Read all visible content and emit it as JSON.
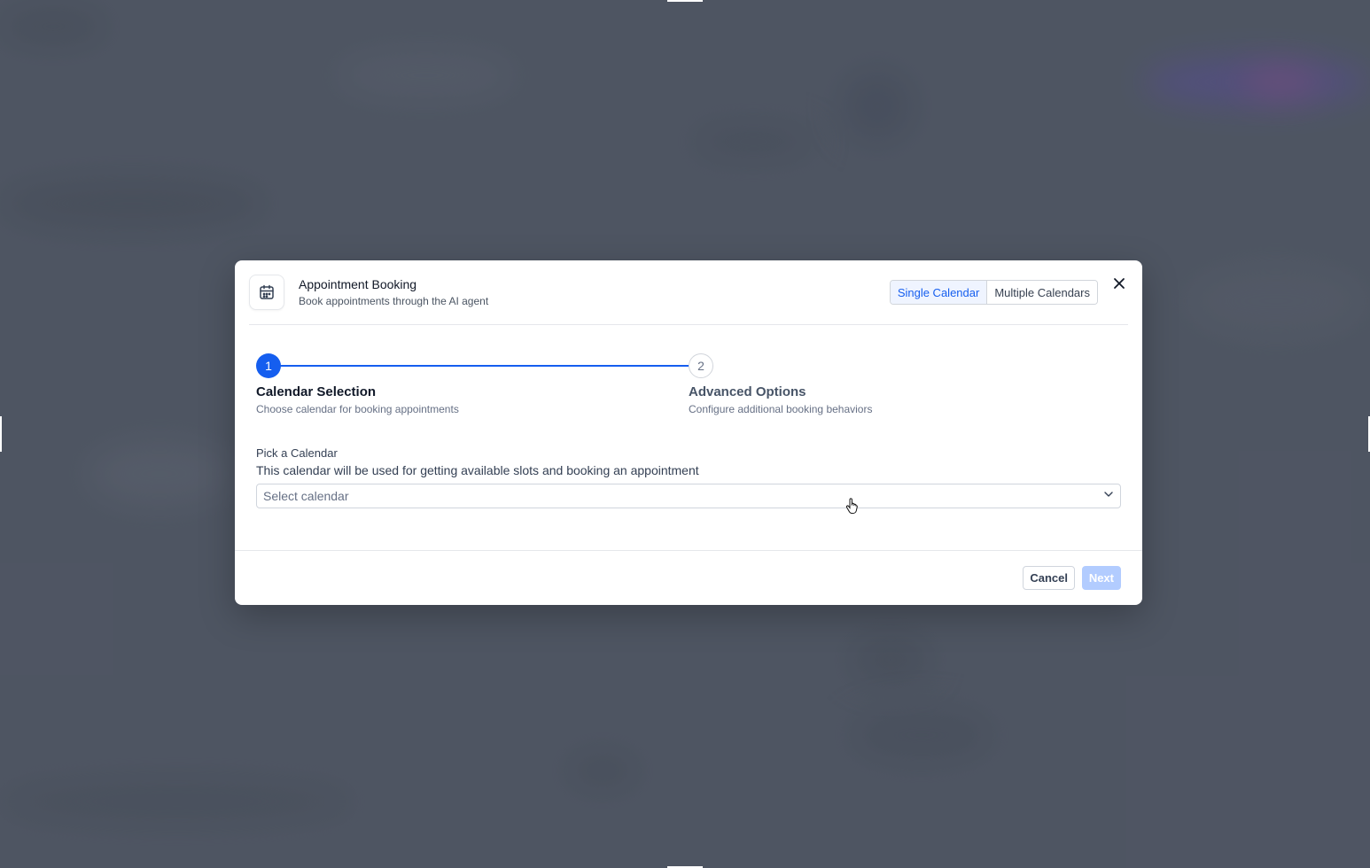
{
  "modal": {
    "title": "Appointment Booking",
    "subtitle": "Book appointments through the AI agent",
    "header_icon": "calendar-icon",
    "mode_toggle": {
      "options": [
        "Single Calendar",
        "Multiple Calendars"
      ],
      "selected": "Single Calendar"
    },
    "close_icon": "close-icon"
  },
  "stepper": {
    "steps": [
      {
        "number": "1",
        "title": "Calendar Selection",
        "description": "Choose calendar for booking appointments",
        "state": "active"
      },
      {
        "number": "2",
        "title": "Advanced Options",
        "description": "Configure additional booking behaviors",
        "state": "inactive"
      }
    ]
  },
  "form": {
    "label": "Pick a Calendar",
    "help_text": "This calendar will be used for getting available slots and booking an appointment",
    "select_placeholder": "Select calendar",
    "select_icon": "chevron-down-icon"
  },
  "footer": {
    "cancel_label": "Cancel",
    "next_label": "Next",
    "next_disabled": true
  },
  "colors": {
    "accent": "#155eef",
    "accent_disabled": "#b2ccff",
    "backdrop": "#545a68"
  }
}
